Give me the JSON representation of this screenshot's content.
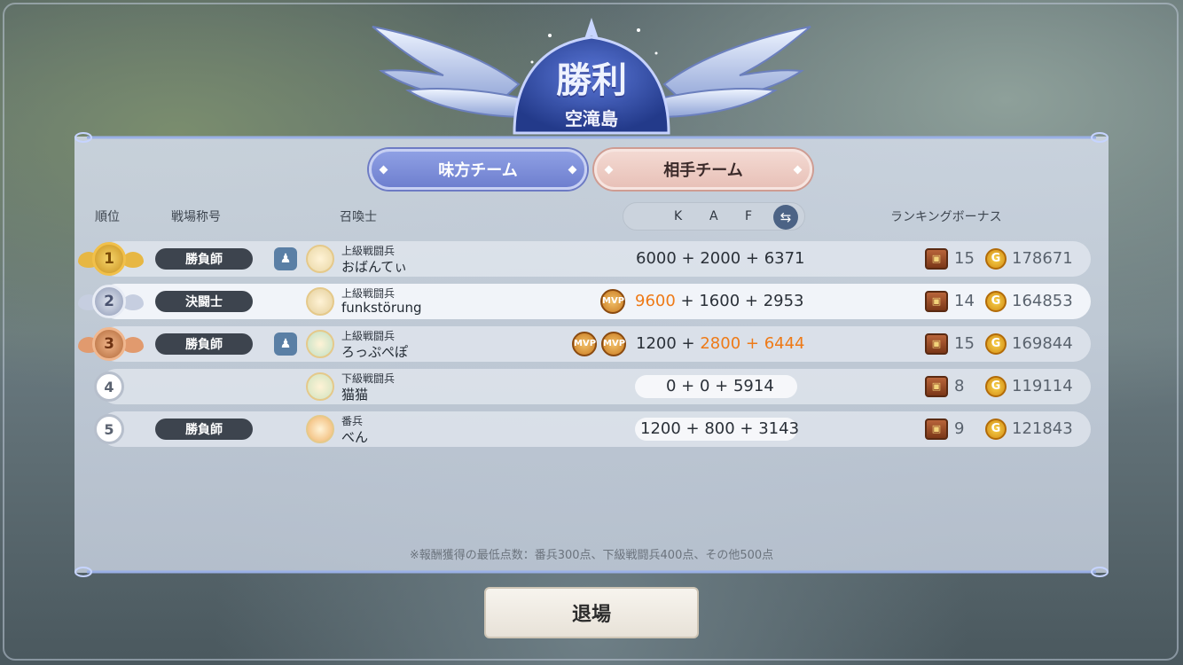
{
  "result": {
    "title": "勝利",
    "map_name": "空滝島"
  },
  "tabs": {
    "ally": "味方チーム",
    "enemy": "相手チーム",
    "active": "enemy"
  },
  "headers": {
    "rank": "順位",
    "battle_title": "戦場称号",
    "summoner": "召喚士",
    "k": "K",
    "a": "A",
    "f": "F",
    "ranking_bonus": "ランキングボーナス"
  },
  "rows": [
    {
      "rank": "1",
      "rank_style": "gold",
      "battle_title": "勝負師",
      "party": true,
      "rank_name": "上級戦闘兵",
      "name": "おばんてぃ",
      "k": "6000",
      "a": "2000",
      "f": "6371",
      "mvp": [],
      "highlight_fields": [],
      "chest": "15",
      "gold": "178671"
    },
    {
      "rank": "2",
      "rank_style": "silver",
      "battle_title": "決闘士",
      "party": false,
      "rank_name": "上級戦闘兵",
      "name": "funkstörung",
      "k": "9600",
      "a": "1600",
      "f": "2953",
      "mvp": [
        "MVP"
      ],
      "highlight_fields": [
        "k"
      ],
      "chest": "14",
      "gold": "164853"
    },
    {
      "rank": "3",
      "rank_style": "bronze",
      "battle_title": "勝負師",
      "party": true,
      "rank_name": "上級戦闘兵",
      "name": "ろっぷぺぽ",
      "k": "1200",
      "a": "2800",
      "f": "6444",
      "mvp": [
        "MVP",
        "MVP"
      ],
      "highlight_fields": [
        "a",
        "f"
      ],
      "chest": "15",
      "gold": "169844"
    },
    {
      "rank": "4",
      "rank_style": "plain",
      "battle_title": "",
      "party": false,
      "rank_name": "下級戦闘兵",
      "name": "猫猫",
      "k": "0",
      "a": "0",
      "f": "5914",
      "mvp": [],
      "highlight_fields": [],
      "chest": "8",
      "gold": "119114"
    },
    {
      "rank": "5",
      "rank_style": "plain",
      "battle_title": "勝負師",
      "party": false,
      "rank_name": "番兵",
      "name": "べん",
      "k": "1200",
      "a": "800",
      "f": "3143",
      "mvp": [],
      "highlight_fields": [],
      "chest": "9",
      "gold": "121843"
    }
  ],
  "score_separator": "+",
  "icons": {
    "party": "party-icon",
    "mvp": "mvp-icon",
    "chest": "treasure-chest-icon",
    "coin": "gold-coin-icon",
    "coin_letter": "G",
    "swap": "swap-arrows-icon"
  },
  "note": "※報酬獲得の最低点数：番兵300点、下級戦闘兵400点、その他500点",
  "exit_label": "退場",
  "colors": {
    "highlight_score": "#ee7a17",
    "ally_tab": "#7e8fd9",
    "enemy_tab": "#ecccc4"
  }
}
